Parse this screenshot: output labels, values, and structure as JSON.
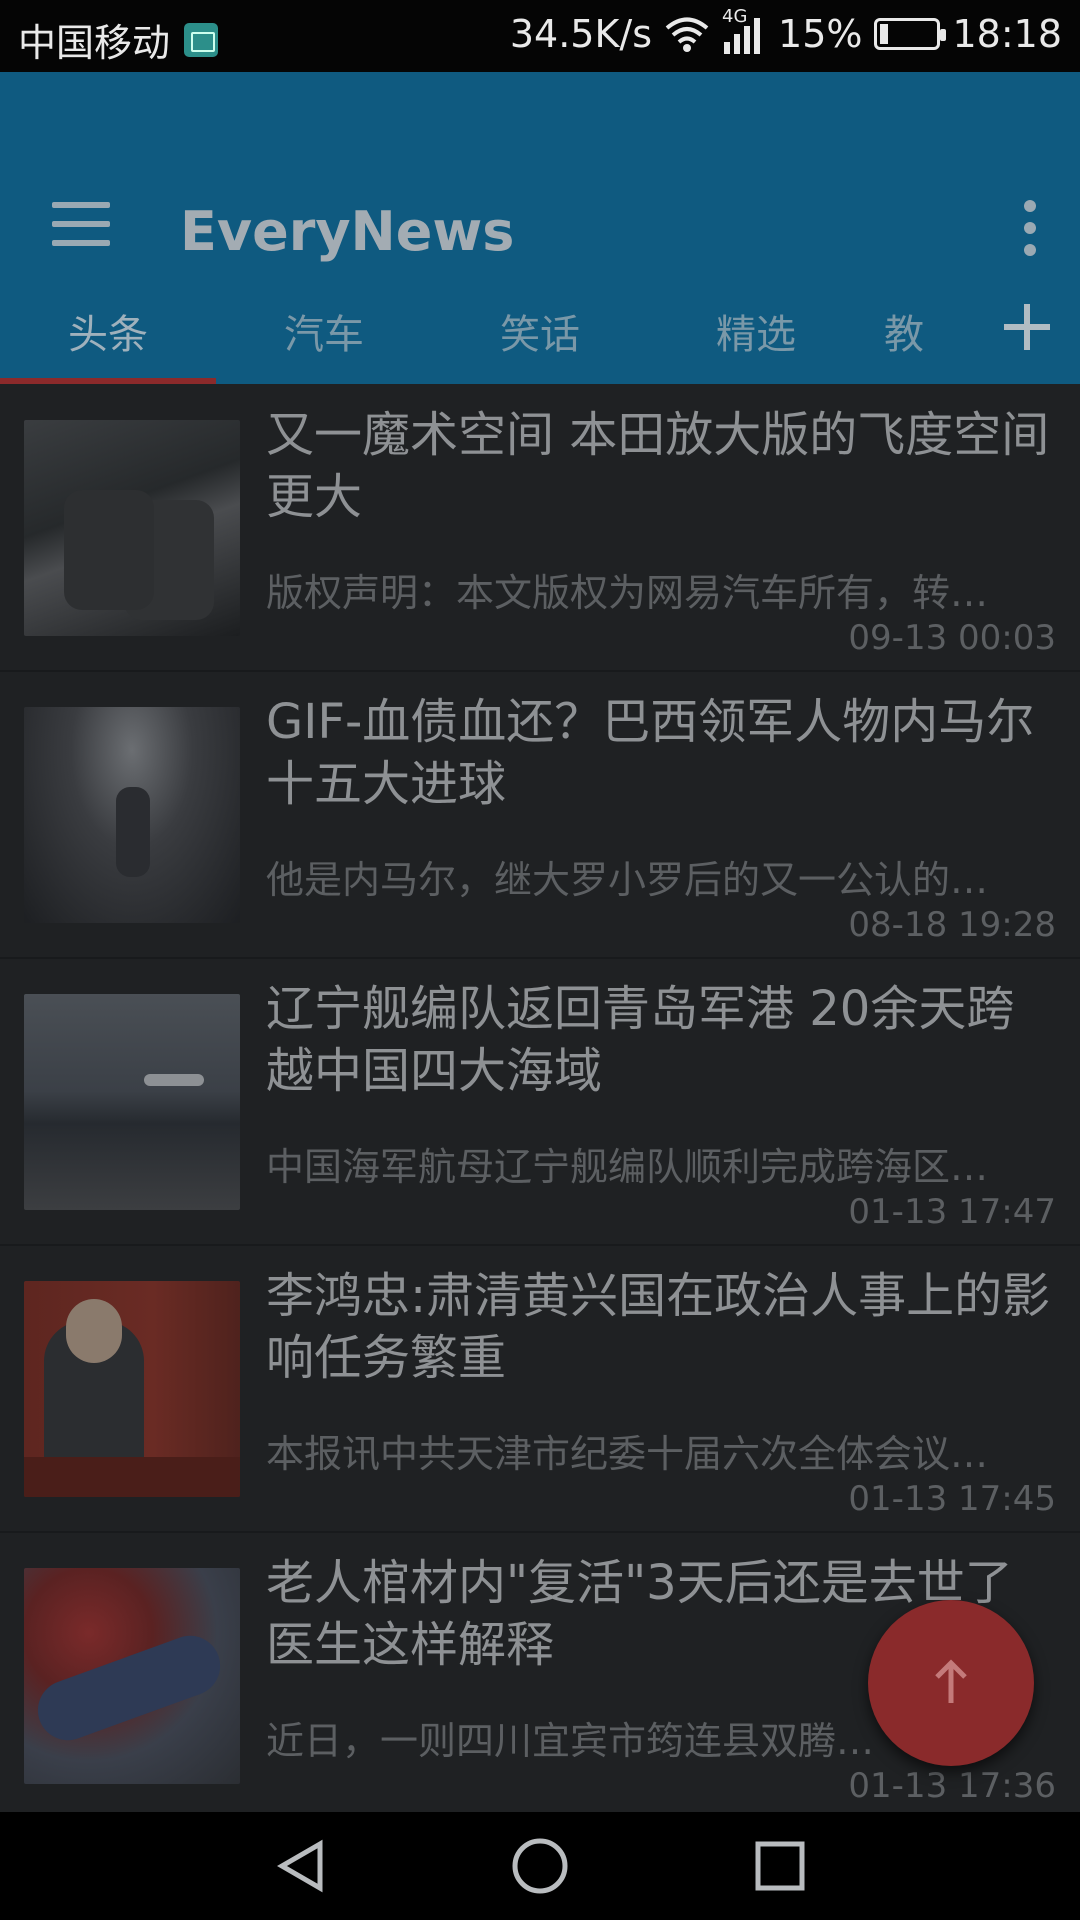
{
  "status_bar": {
    "carrier": "中国移动",
    "net_speed": "34.5K/s",
    "network_type": "4G",
    "battery": "15%",
    "time": "18:18",
    "icons": [
      "gallery-icon",
      "wifi-icon",
      "signal-icon",
      "battery-icon"
    ]
  },
  "app_bar": {
    "title": "EveryNews",
    "menu_icon": "hamburger-menu-icon",
    "more_icon": "more-vertical-icon"
  },
  "tabs": {
    "items": [
      "头条",
      "汽车",
      "笑话",
      "精选",
      "教"
    ],
    "active": "头条",
    "add_icon": "plus-icon"
  },
  "news": [
    {
      "title": "又一魔术空间 本田放大版的飞度空间更大",
      "summary": "版权声明：本文版权为网易汽车所有，转…",
      "time": "09-13 00:03"
    },
    {
      "title": "GIF-血债血还？巴西领军人物内马尔十五大进球",
      "summary": "他是内马尔，继大罗小罗后的又一公认的…",
      "time": "08-18 19:28"
    },
    {
      "title": "辽宁舰编队返回青岛军港 20余天跨越中国四大海域",
      "summary": "中国海军航母辽宁舰编队顺利完成跨海区…",
      "time": "01-13 17:47"
    },
    {
      "title": "李鸿忠:肃清黄兴国在政治人事上的影响任务繁重",
      "summary": "本报讯中共天津市纪委十届六次全体会议…",
      "time": "01-13 17:45"
    },
    {
      "title": "老人棺材内\"复活\"3天后还是去世了 医生这样解释",
      "summary": "近日，一则四川宜宾市筠连县双腾…",
      "time": "01-13 17:36"
    }
  ],
  "fab": {
    "icon": "arrow-up-icon"
  },
  "nav_bar": {
    "icons": [
      "back-icon",
      "home-icon",
      "recents-icon"
    ]
  }
}
